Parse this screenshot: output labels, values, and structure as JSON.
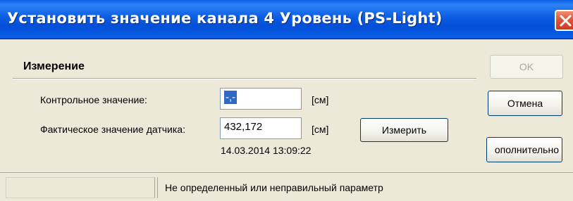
{
  "window": {
    "title": "Установить значение канала  4 Уровень (PS-Light)",
    "close_icon": "close-icon"
  },
  "section": {
    "title": "Измерение"
  },
  "fields": {
    "control_label": "Контрольное значение:",
    "control_value": "-,-",
    "control_unit": "[см]",
    "actual_label": "Фактическое значение датчика:",
    "actual_value": "432,172",
    "actual_unit": "[см]",
    "timestamp": "14.03.2014 13:09:22"
  },
  "buttons": {
    "measure": "Измерить",
    "ok": "OK",
    "cancel": "Отмена",
    "advanced": "ополнительно"
  },
  "status": {
    "message": "Не определенный или неправильный параметр"
  },
  "colors": {
    "titlebar": "#0a5ee6",
    "close": "#e0543a",
    "selection": "#316ac5",
    "dialog_bg": "#ece9d8"
  }
}
